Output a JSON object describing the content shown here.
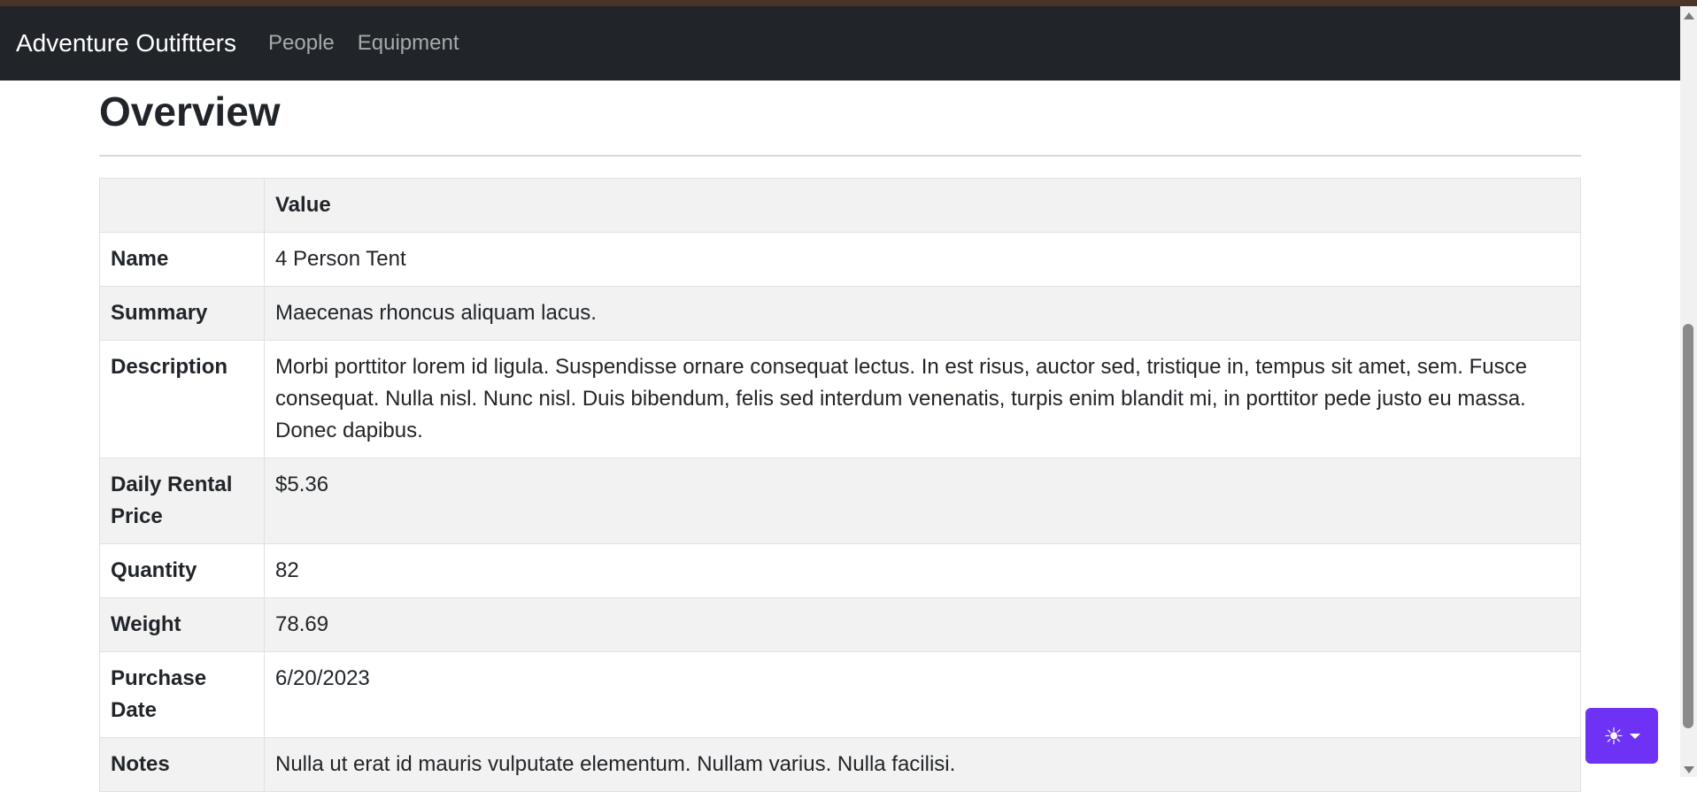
{
  "navbar": {
    "brand": "Adventure Outiftters",
    "links": [
      "People",
      "Equipment"
    ]
  },
  "main": {
    "title": "Overview",
    "table": {
      "header": [
        "",
        "Value"
      ],
      "rows": [
        {
          "label": "Name",
          "value": "4 Person Tent"
        },
        {
          "label": "Summary",
          "value": "Maecenas rhoncus aliquam lacus."
        },
        {
          "label": "Description",
          "value": "Morbi porttitor lorem id ligula. Suspendisse ornare consequat lectus. In est risus, auctor sed, tristique in, tempus sit amet, sem. Fusce consequat. Nulla nisl. Nunc nisl. Duis bibendum, felis sed interdum venenatis, turpis enim blandit mi, in porttitor pede justo eu massa. Donec dapibus."
        },
        {
          "label": "Daily Rental Price",
          "value": "$5.36"
        },
        {
          "label": "Quantity",
          "value": "82"
        },
        {
          "label": "Weight",
          "value": "78.69"
        },
        {
          "label": "Purchase Date",
          "value": "6/20/2023"
        },
        {
          "label": "Notes",
          "value": "Nulla ut erat id mauris vulputate elementum. Nullam varius. Nulla facilisi."
        }
      ]
    }
  },
  "theme_toggle": {
    "icon": "sun-icon",
    "color": "#6e32f5"
  },
  "colors": {
    "navbar_bg": "#212529",
    "stripe_bg": "#f2f2f2"
  }
}
